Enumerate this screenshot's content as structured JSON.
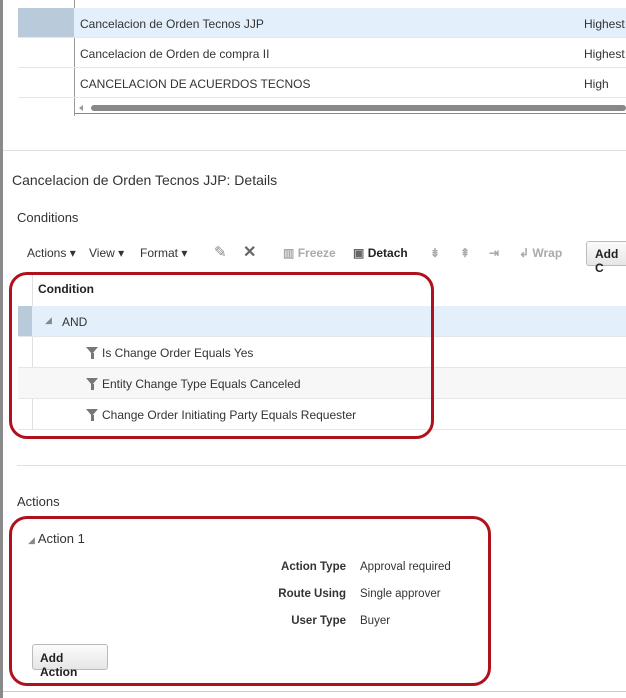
{
  "rules_table": {
    "rows": [
      {
        "name": "Cancelacion de Orden Tecnos JJP",
        "priority": "Highest",
        "selected": true
      },
      {
        "name": "Cancelacion de Orden de compra II",
        "priority": "Highest",
        "selected": false
      },
      {
        "name": "CANCELACION DE ACUERDOS TECNOS",
        "priority": "High",
        "selected": false
      }
    ]
  },
  "details_title": "Cancelacion de Orden Tecnos JJP: Details",
  "conditions": {
    "title": "Conditions",
    "toolbar": {
      "actions": "Actions",
      "view": "View",
      "format": "Format",
      "freeze": "Freeze",
      "detach": "Detach",
      "wrap": "Wrap",
      "add": "Add C"
    },
    "header": "Condition",
    "root": "AND",
    "items": [
      "Is Change Order Equals Yes",
      "Entity Change Type Equals Canceled",
      "Change Order Initiating Party Equals Requester"
    ]
  },
  "actions": {
    "title": "Actions",
    "action_name": "Action 1",
    "fields": [
      {
        "label": "Action Type",
        "value": "Approval required"
      },
      {
        "label": "Route Using",
        "value": "Single approver"
      },
      {
        "label": "User Type",
        "value": "Buyer"
      }
    ],
    "add_button": "Add Action"
  },
  "colors": {
    "highlight": "#e3f0fb",
    "selector": "#b9cbdb",
    "annotation": "#b0121b"
  }
}
